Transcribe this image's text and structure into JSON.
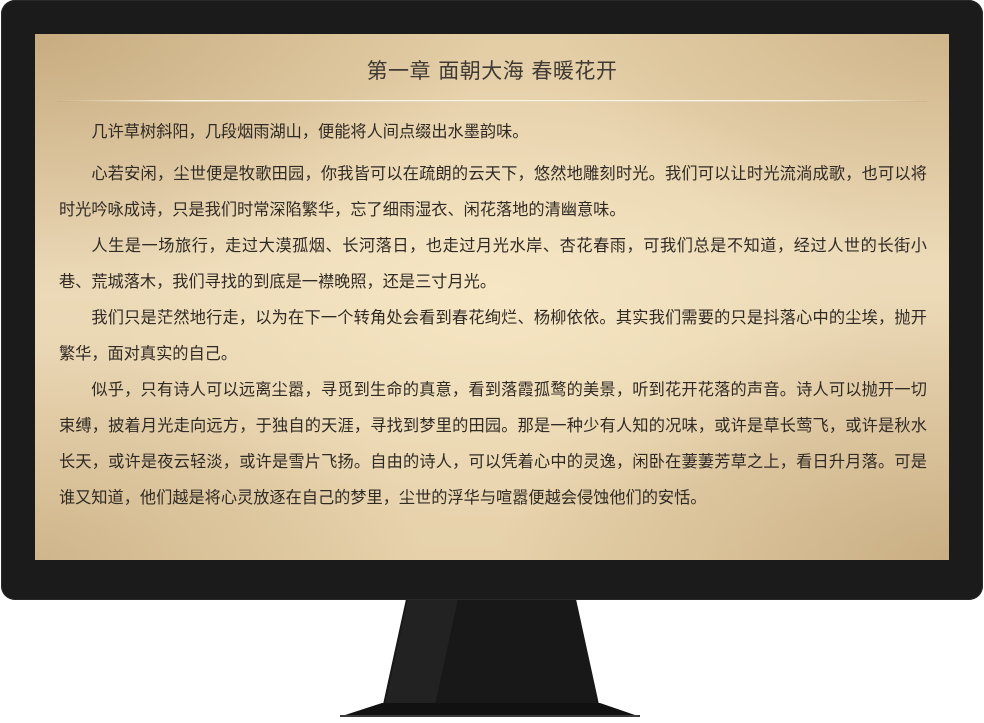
{
  "reader": {
    "chapter_title": "第一章  面朝大海 春暖花开",
    "paragraphs": [
      "几许草树斜阳，几段烟雨湖山，便能将人间点缀出水墨韵味。",
      "心若安闲，尘世便是牧歌田园，你我皆可以在疏朗的云天下，悠然地雕刻时光。我们可以让时光流淌成歌，也可以将时光吟咏成诗，只是我们时常深陷繁华，忘了细雨湿衣、闲花落地的清幽意味。",
      "人生是一场旅行，走过大漠孤烟、长河落日，也走过月光水岸、杏花春雨，可我们总是不知道，经过人世的长街小巷、荒城落木，我们寻找的到底是一襟晚照，还是三寸月光。",
      "我们只是茫然地行走，以为在下一个转角处会看到春花绚烂、杨柳依依。其实我们需要的只是抖落心中的尘埃，抛开繁华，面对真实的自己。",
      "似乎，只有诗人可以远离尘嚣，寻觅到生命的真意，看到落霞孤鹜的美景，听到花开花落的声音。诗人可以抛开一切束缚，披着月光走向远方，于独自的天涯，寻找到梦里的田园。那是一种少有人知的况味，或许是草长莺飞，或许是秋水长天，或许是夜云轻淡，或许是雪片飞扬。自由的诗人，可以凭着心中的灵逸，闲卧在萋萋芳草之上，看日升月落。可是谁又知道，他们越是将心灵放逐在自己的梦里，尘世的浮华与喧嚣便越会侵蚀他们的安恬。"
    ]
  },
  "colors": {
    "bezel": "#1b1b1b",
    "paper": "#ecdab8",
    "text": "#2f2a24",
    "title": "#3f3a33"
  }
}
